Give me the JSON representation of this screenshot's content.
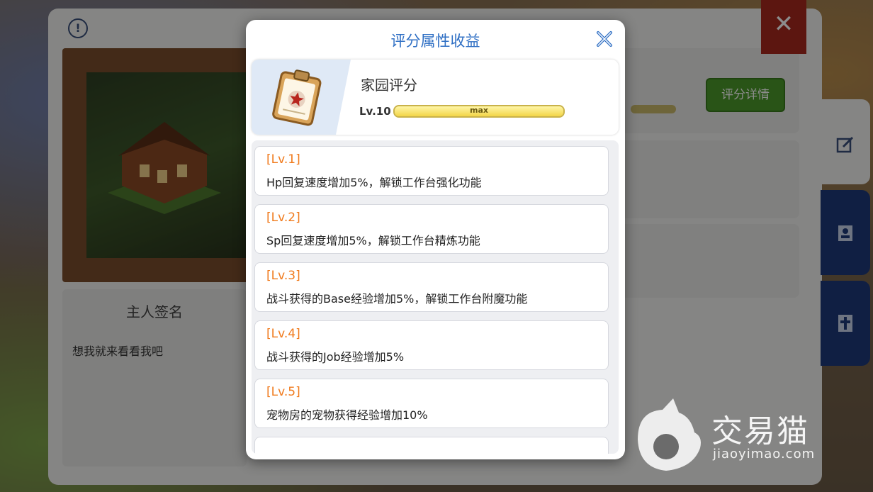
{
  "background": {
    "signature_title": "主人签名",
    "signature_text": "想我就来看看我吧",
    "detail_button": "评分详情"
  },
  "modal": {
    "title": "评分属性收益",
    "header": {
      "name": "家园评分",
      "level": "Lv.10",
      "progress_label": "max",
      "progress_fraction": 1.0
    },
    "levels": [
      {
        "tag": "[Lv.1]",
        "desc": "Hp回复速度增加5%，解锁工作台强化功能"
      },
      {
        "tag": "[Lv.2]",
        "desc": "Sp回复速度增加5%，解锁工作台精炼功能"
      },
      {
        "tag": "[Lv.3]",
        "desc": "战斗获得的Base经验增加5%，解锁工作台附魔功能"
      },
      {
        "tag": "[Lv.4]",
        "desc": "战斗获得的Job经验增加5%"
      },
      {
        "tag": "[Lv.5]",
        "desc": "宠物房的宠物获得经验增加10%"
      }
    ]
  },
  "watermark": {
    "text": "交易猫",
    "url": "jiaoyimao.com"
  },
  "colors": {
    "title_blue": "#2f6fc4",
    "level_orange": "#f07a1c",
    "button_green": "#4b9a2a",
    "close_red": "#a8281e"
  }
}
